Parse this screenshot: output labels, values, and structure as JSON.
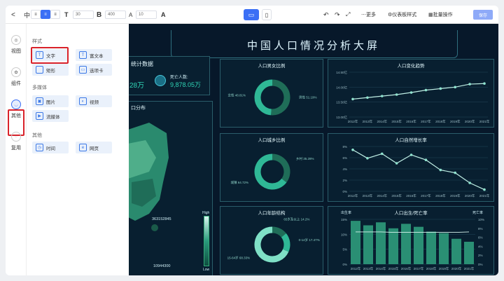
{
  "toolbar": {
    "back": "<",
    "title": "中",
    "font_size": "30",
    "weight": "400",
    "letter_spacing": "10",
    "bold": "B",
    "color": "A",
    "more": "更多",
    "dashboard_style": "仪表板样式",
    "batch": "批量操作",
    "save": "保存"
  },
  "rail": [
    {
      "label": "视图"
    },
    {
      "label": "组件"
    },
    {
      "label": "其他"
    },
    {
      "label": "复用"
    }
  ],
  "panel": {
    "sections": [
      {
        "title": "样式",
        "items": [
          "文字",
          "富文本",
          "矩形",
          "选项卡"
        ]
      },
      {
        "title": "多媒体",
        "items": [
          "图片",
          "视频",
          "流媒体"
        ]
      },
      {
        "title": "其他",
        "items": [
          "时间",
          "网页"
        ]
      }
    ]
  },
  "dashboard": {
    "title": "中国人口情况分析大屏",
    "stat_title": "统计数据",
    "stat_left_value": "28万",
    "death_label": "死亡人数:",
    "death_value": "9,878.05万",
    "map_title": "口分布",
    "map_max": "363152845",
    "map_min": "10944300",
    "legend_high": "High",
    "legend_low": "Low"
  },
  "chart_data": [
    {
      "type": "pie",
      "title": "人口男女比例",
      "labels": [
        "男性",
        "女性"
      ],
      "values": [
        51.19,
        48.81
      ],
      "label_text": [
        "男性 51.19%",
        "女性 48.81%"
      ]
    },
    {
      "type": "line",
      "title": "人口变化趋势",
      "categories": [
        "2012年",
        "2013年",
        "2014年",
        "2015年",
        "2016年",
        "2017年",
        "2018年",
        "2019年",
        "2020年",
        "2021年"
      ],
      "values": [
        13.6,
        13.65,
        13.7,
        13.75,
        13.82,
        13.9,
        13.95,
        14.0,
        14.1,
        14.12
      ],
      "yticks": [
        "13.00亿",
        "13.50亿",
        "14.00亿",
        "14.50亿"
      ],
      "ylim": [
        13.0,
        14.5
      ]
    },
    {
      "type": "pie",
      "title": "人口城乡比例",
      "labels": [
        "乡村",
        "城镇"
      ],
      "values": [
        35.28,
        64.72
      ],
      "label_text": [
        "乡村 35.28%",
        "城镇 64.72%"
      ]
    },
    {
      "type": "line",
      "title": "人口自然增长率",
      "categories": [
        "2012年",
        "2013年",
        "2014年",
        "2015年",
        "2016年",
        "2017年",
        "2018年",
        "2019年",
        "2020年",
        "2021年"
      ],
      "values": [
        7.4,
        5.9,
        6.7,
        5.0,
        6.5,
        5.6,
        3.8,
        3.3,
        1.5,
        0.3
      ],
      "yticks": [
        "0%",
        "2%",
        "4%",
        "6%",
        "8%"
      ],
      "ylim": [
        0,
        8
      ]
    },
    {
      "type": "pie",
      "title": "人口年龄结构",
      "labels": [
        "65岁及以上",
        "0-14岁",
        "15-64岁"
      ],
      "values": [
        14.2,
        17.5,
        68.3
      ],
      "label_text": [
        "65岁及以上 14.2%",
        "0-14岁 17.47%",
        "15-64岁 68.33%"
      ]
    },
    {
      "type": "bar",
      "title": "人口出生/死亡率",
      "left_axis": "出生率",
      "right_axis": "死亡率",
      "categories": [
        "2012年",
        "2013年",
        "2014年",
        "2015年",
        "2016年",
        "2017年",
        "2018年",
        "2019年",
        "2020年",
        "2021年"
      ],
      "values": [
        14.5,
        13.0,
        14.0,
        12.0,
        13.5,
        12.5,
        10.9,
        10.4,
        8.5,
        7.5
      ],
      "yticks": [
        "0%",
        "5%",
        "10%",
        "15%"
      ],
      "ylim": [
        0,
        15
      ],
      "rticks": [
        "0%",
        "2%",
        "4%",
        "6%",
        "8%",
        "10%"
      ],
      "line_values": [
        7.2,
        7.2,
        7.2,
        7.1,
        7.1,
        7.1,
        7.1,
        7.1,
        7.1,
        7.2
      ]
    }
  ]
}
